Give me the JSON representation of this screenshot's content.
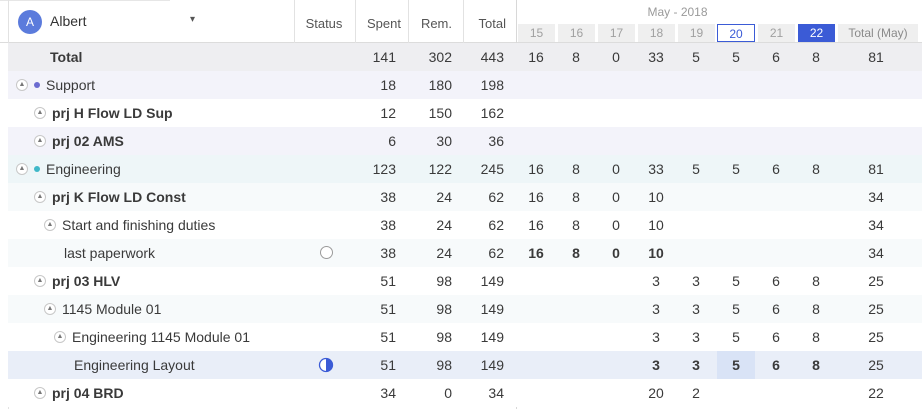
{
  "user": {
    "avatar_letter": "A",
    "name": "Albert"
  },
  "columns": {
    "status": "Status",
    "spent": "Spent",
    "rem": "Rem.",
    "total": "Total"
  },
  "calendar": {
    "month": "May - 2018",
    "days": [
      "15",
      "16",
      "17",
      "18",
      "19",
      "20",
      "21",
      "22"
    ],
    "today": "20",
    "selected": "22",
    "total_label": "Total (May)"
  },
  "rows": [
    {
      "name": "Total",
      "spent": "141",
      "rem": "302",
      "total": "443",
      "days": [
        "16",
        "8",
        "0",
        "33",
        "5",
        "5",
        "6",
        "8"
      ],
      "month_total": "81"
    },
    {
      "name": "Support",
      "spent": "18",
      "rem": "180",
      "total": "198",
      "days": [
        "",
        "",
        "",
        "",
        "",
        "",
        "",
        ""
      ],
      "month_total": ""
    },
    {
      "name": "prj H Flow LD Sup",
      "spent": "12",
      "rem": "150",
      "total": "162",
      "days": [
        "",
        "",
        "",
        "",
        "",
        "",
        "",
        ""
      ],
      "month_total": ""
    },
    {
      "name": "prj 02 AMS",
      "spent": "6",
      "rem": "30",
      "total": "36",
      "days": [
        "",
        "",
        "",
        "",
        "",
        "",
        "",
        ""
      ],
      "month_total": ""
    },
    {
      "name": "Engineering",
      "spent": "123",
      "rem": "122",
      "total": "245",
      "days": [
        "16",
        "8",
        "0",
        "33",
        "5",
        "5",
        "6",
        "8"
      ],
      "month_total": "81"
    },
    {
      "name": "prj K Flow LD Const",
      "spent": "38",
      "rem": "24",
      "total": "62",
      "days": [
        "16",
        "8",
        "0",
        "10",
        "",
        "",
        "",
        ""
      ],
      "month_total": "34"
    },
    {
      "name": "Start and finishing duties",
      "spent": "38",
      "rem": "24",
      "total": "62",
      "days": [
        "16",
        "8",
        "0",
        "10",
        "",
        "",
        "",
        ""
      ],
      "month_total": "34"
    },
    {
      "name": "last paperwork",
      "spent": "38",
      "rem": "24",
      "total": "62",
      "days": [
        "16",
        "8",
        "0",
        "10",
        "",
        "",
        "",
        ""
      ],
      "month_total": "34"
    },
    {
      "name": "prj 03 HLV",
      "spent": "51",
      "rem": "98",
      "total": "149",
      "days": [
        "",
        "",
        "",
        "3",
        "3",
        "5",
        "6",
        "8"
      ],
      "month_total": "25"
    },
    {
      "name": "1145 Module 01",
      "spent": "51",
      "rem": "98",
      "total": "149",
      "days": [
        "",
        "",
        "",
        "3",
        "3",
        "5",
        "6",
        "8"
      ],
      "month_total": "25"
    },
    {
      "name": "Engineering 1145 Module 01",
      "spent": "51",
      "rem": "98",
      "total": "149",
      "days": [
        "",
        "",
        "",
        "3",
        "3",
        "5",
        "6",
        "8"
      ],
      "month_total": "25"
    },
    {
      "name": "Engineering Layout",
      "spent": "51",
      "rem": "98",
      "total": "149",
      "days": [
        "",
        "",
        "",
        "3",
        "3",
        "5",
        "6",
        "8"
      ],
      "month_total": "25"
    },
    {
      "name": "prj 04 BRD",
      "spent": "34",
      "rem": "0",
      "total": "34",
      "days": [
        "",
        "",
        "",
        "20",
        "2",
        "",
        "",
        ""
      ],
      "month_total": "22"
    }
  ],
  "colors": {
    "accent": "#3b5bd6",
    "support_dot": "#6b6bd0",
    "engineering_dot": "#3fb8c8"
  },
  "icons": {
    "status_open": "circle-outline-icon",
    "status_progress": "pie-progress-icon",
    "toggle": "chevron-up-icon",
    "dropdown": "caret-down-icon"
  }
}
